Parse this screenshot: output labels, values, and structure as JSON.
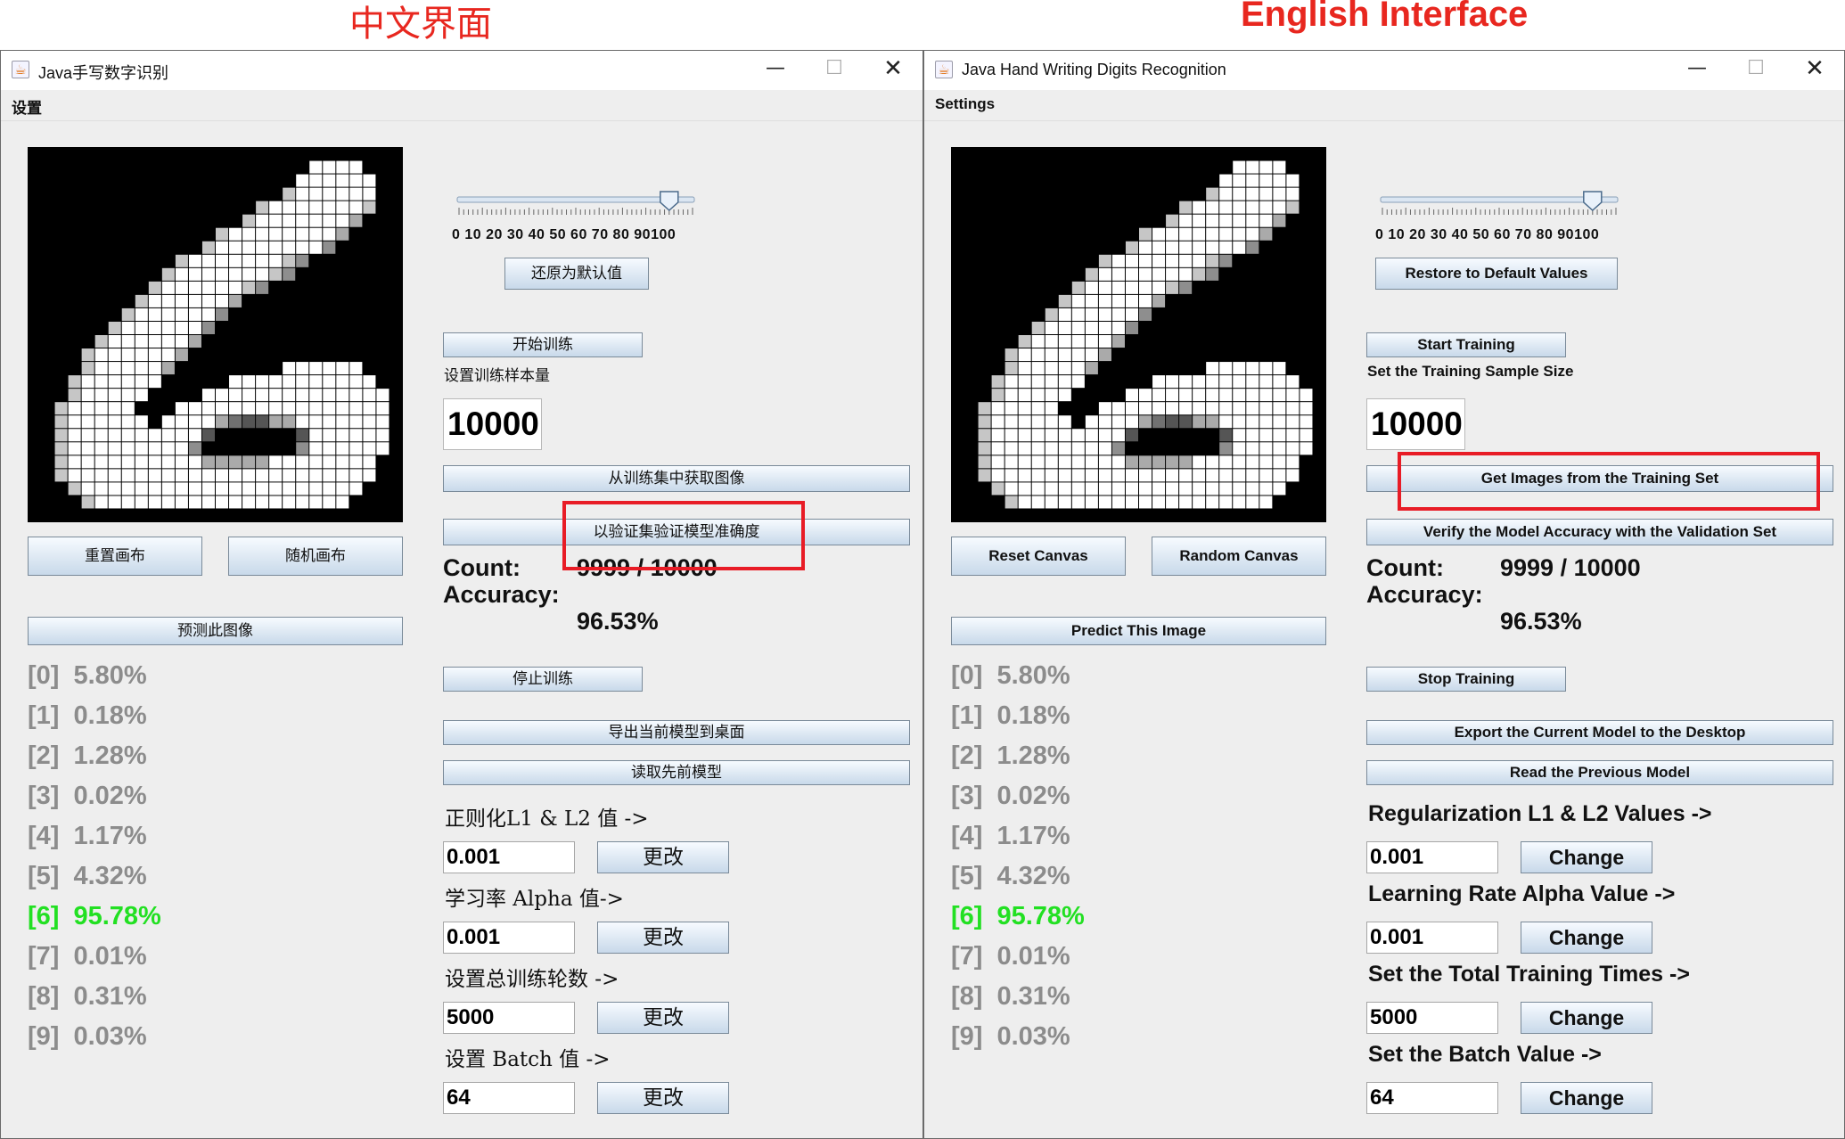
{
  "captions": {
    "zh": "中文界面",
    "en": "English Interface"
  },
  "windows": [
    {
      "key": "zh",
      "title": "Java手写数字识别",
      "menu": "设置",
      "slider": {
        "ticks": "0  10  20  30  40  50  60  70  80  90100",
        "value": 90
      },
      "restore_label": "还原为默认值",
      "start_label": "开始训练",
      "sample_size_label": "设置训练样本量",
      "sample_size": "10000",
      "get_images_label": "从训练集中获取图像",
      "verify_label": "以验证集验证模型准确度",
      "count_label": "Count:",
      "count_value": "9999  / 10000",
      "accuracy_label": "Accuracy:",
      "accuracy_value": "96.53%",
      "reset_label": "重置画布",
      "random_label": "随机画布",
      "predict_label": "预测此图像",
      "stop_label": "停止训练",
      "export_label": "导出当前模型到桌面",
      "read_label": "读取先前模型",
      "reg_label": "正则化L1 & L2 值 ->",
      "reg_value": "0.001",
      "lr_label": "学习率 Alpha 值->",
      "lr_value": "0.001",
      "epochs_label": "设置总训练轮数 ->",
      "epochs_value": "5000",
      "batch_label": "设置 Batch 值 ->",
      "batch_value": "64",
      "change_label": "更改"
    },
    {
      "key": "en",
      "title": "Java Hand Writing Digits Recognition",
      "menu": "Settings",
      "slider": {
        "ticks": "0  10  20  30  40  50  60  70  80  90100",
        "value": 90
      },
      "restore_label": "Restore to Default Values",
      "start_label": "Start Training",
      "sample_size_label": "Set the Training Sample Size",
      "sample_size": "10000",
      "get_images_label": "Get Images from the Training Set",
      "verify_label": "Verify the Model Accuracy with the Validation Set",
      "count_label": "Count:",
      "count_value": "9999  / 10000",
      "accuracy_label": "Accuracy:",
      "accuracy_value": "96.53%",
      "reset_label": "Reset Canvas",
      "random_label": "Random Canvas",
      "predict_label": "Predict This Image",
      "stop_label": "Stop Training",
      "export_label": "Export the Current Model to the Desktop",
      "read_label": "Read the Previous Model",
      "reg_label": "Regularization L1 & L2 Values ->",
      "reg_value": "0.001",
      "lr_label": "Learning Rate Alpha Value ->",
      "lr_value": "0.001",
      "epochs_label": "Set the Total Training Times ->",
      "epochs_value": "5000",
      "batch_label": "Set the Batch Value ->",
      "batch_value": "64",
      "change_label": "Change"
    }
  ],
  "predictions": [
    {
      "label": "[0]",
      "value": "5.80%"
    },
    {
      "label": "[1]",
      "value": "0.18%"
    },
    {
      "label": "[2]",
      "value": "1.28%"
    },
    {
      "label": "[3]",
      "value": "0.02%"
    },
    {
      "label": "[4]",
      "value": "1.17%"
    },
    {
      "label": "[5]",
      "value": "4.32%"
    },
    {
      "label": "[6]",
      "value": "95.78%",
      "highlight": true
    },
    {
      "label": "[7]",
      "value": "0.01%"
    },
    {
      "label": "[8]",
      "value": "0.31%"
    },
    {
      "label": "[9]",
      "value": "0.03%"
    }
  ],
  "colors": {
    "highlight": "#22e022",
    "caption": "#e8271f",
    "muted": "#8c8c8c",
    "annotation_box": "#e81c26"
  }
}
